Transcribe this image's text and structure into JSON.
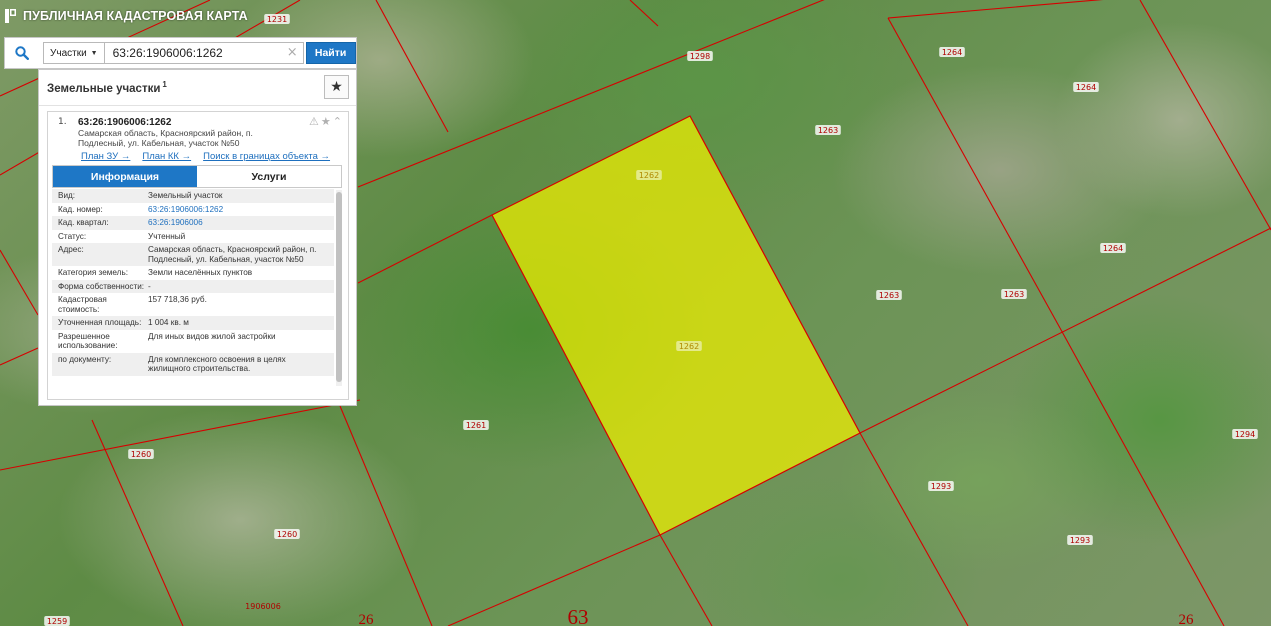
{
  "app": {
    "title": "ПУБЛИЧНАЯ КАДАСТРОВАЯ КАРТА",
    "logo_icon": "pkk-logo-icon"
  },
  "search": {
    "type_label": "Участки",
    "query": "63:26:1906006:1262",
    "button_label": "Найти",
    "clear_symbol": "×"
  },
  "results": {
    "title": "Земельные участки",
    "count": "1",
    "items": [
      {
        "index": "1.",
        "number": "63:26:1906006:1262",
        "address": "Самарская область, Красноярский район, п. Подлесный, ул. Кабельная, участок №50",
        "links": [
          "План ЗУ →",
          "План КК →",
          "Поиск в границах объекта →"
        ],
        "tabs": [
          "Информация",
          "Услуги"
        ],
        "active_tab": "Информация",
        "info": [
          {
            "key": "Вид:",
            "value": "Земельный участок"
          },
          {
            "key": "Кад. номер:",
            "value": "63:26:1906006:1262",
            "link": true
          },
          {
            "key": "Кад. квартал:",
            "value": "63:26:1906006",
            "link": true
          },
          {
            "key": "Статус:",
            "value": "Учтенный"
          },
          {
            "key": "Адрес:",
            "value": "Самарская область, Красноярский район, п. Подлесный, ул. Кабельная, участок №50"
          },
          {
            "key": "Категория земель:",
            "value": "Земли населённых пунктов"
          },
          {
            "key": "Форма собственности:",
            "value": "-"
          },
          {
            "key": "Кадастровая стоимость:",
            "value": "157 718,36 руб."
          },
          {
            "key": "Уточненная площадь:",
            "value": "1 004 кв. м"
          },
          {
            "key": "Разрешенное использование:",
            "value": "Для иных видов жилой застройки"
          },
          {
            "key": "по документу:",
            "value": "Для комплексного освоения в целях жилищного строительства."
          }
        ]
      }
    ]
  },
  "map": {
    "selected_plot": "1262",
    "plot_labels": [
      {
        "text": "1231"
      },
      {
        "text": "1298"
      },
      {
        "text": "1264"
      },
      {
        "text": "1264"
      },
      {
        "text": "1263"
      },
      {
        "text": "1264"
      },
      {
        "text": "1263"
      },
      {
        "text": "1263"
      },
      {
        "text": "1262"
      },
      {
        "text": "1262"
      },
      {
        "text": "1261"
      },
      {
        "text": "1260"
      },
      {
        "text": "1260"
      },
      {
        "text": "1294"
      },
      {
        "text": "1293"
      },
      {
        "text": "1293"
      },
      {
        "text": "1906006"
      },
      {
        "text": "1259"
      }
    ],
    "quarter_labels": [
      "26",
      "63",
      "26"
    ],
    "colors": {
      "boundary": "#d60000",
      "selected_fill": "#f0f000",
      "selected_stroke": "#d60000",
      "accent": "#1e77c6"
    }
  }
}
